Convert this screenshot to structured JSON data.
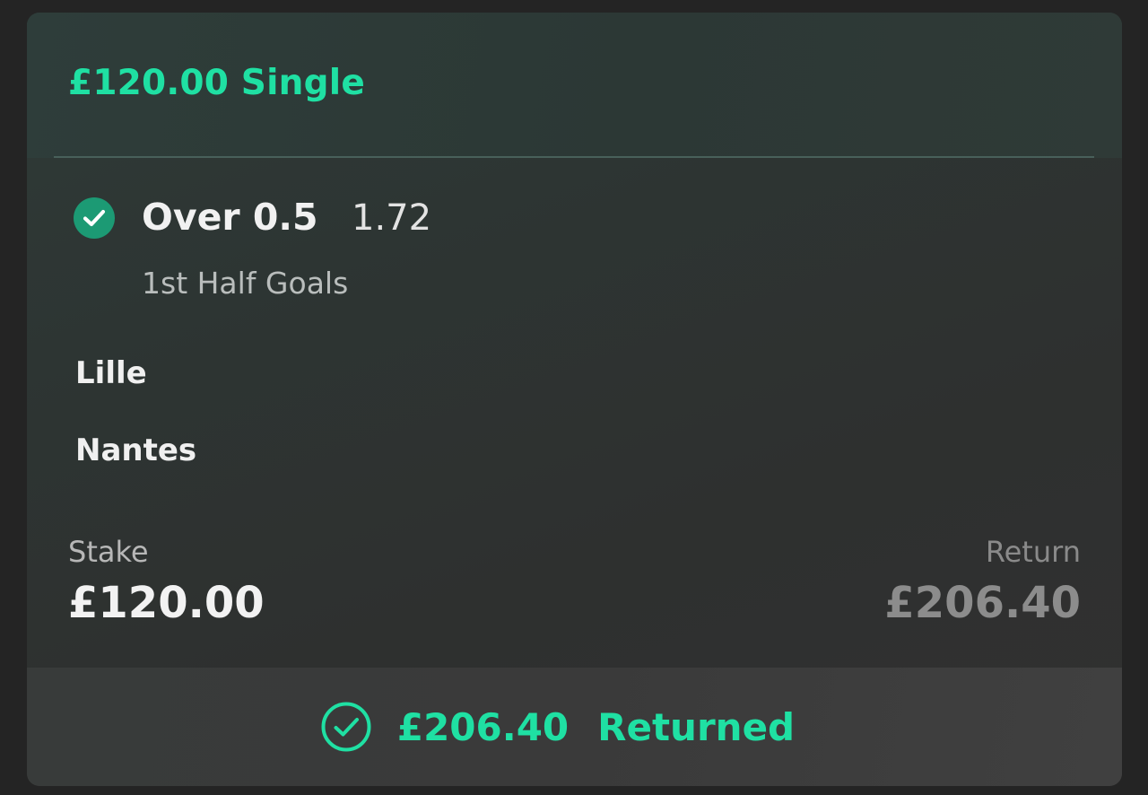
{
  "bet": {
    "title": "£120.00 Single",
    "selection": "Over 0.5",
    "odds": "1.72",
    "market": "1st Half Goals",
    "home_team": "Lille",
    "away_team": "Nantes",
    "status": "won"
  },
  "stake": {
    "label": "Stake",
    "value": "£120.00"
  },
  "return": {
    "label": "Return",
    "value": "£206.40"
  },
  "footer": {
    "amount": "£206.40",
    "status_text": "Returned"
  },
  "icons": {
    "selection_status": "check-circle-filled-icon",
    "returned_status": "check-circle-outline-icon"
  },
  "colors": {
    "accent": "#1fe0a3",
    "badge": "#1c9a74"
  }
}
